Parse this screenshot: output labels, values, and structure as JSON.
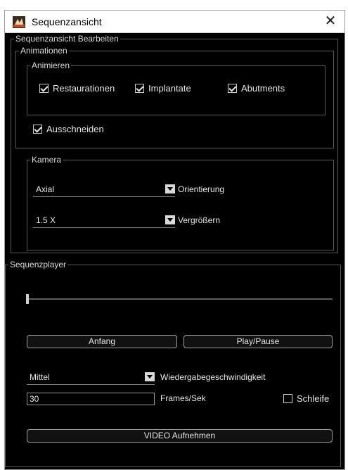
{
  "window": {
    "title": "Sequenzansicht",
    "close_glyph": "✕",
    "icon": "app-icon"
  },
  "edit_group": {
    "legend": "Sequenzansicht Bearbeiten",
    "animations": {
      "legend": "Animationen",
      "animate": {
        "legend": "Animieren",
        "items": [
          {
            "label": "Restaurationen",
            "checked": true
          },
          {
            "label": "Implantate",
            "checked": true
          },
          {
            "label": "Abutments",
            "checked": true
          }
        ]
      },
      "cut": {
        "label": "Ausschneiden",
        "checked": true
      }
    },
    "camera": {
      "legend": "Kamera",
      "orientation": {
        "value": "Axial",
        "label": "Orientierung"
      },
      "zoom": {
        "value": "1.5 X",
        "label": "Vergrößern"
      }
    }
  },
  "player": {
    "legend": "Sequenzplayer",
    "slider_position": 0,
    "start_button": "Anfang",
    "playpause_button": "Play/Pause",
    "speed": {
      "value": "Mittel",
      "label": "Wiedergabegeschwindigkeit"
    },
    "fps": {
      "value": "30",
      "label": "Frames/Sek"
    },
    "loop": {
      "label": "Schleife",
      "checked": false
    },
    "record_button": "VIDEO Aufnehmen"
  },
  "colors": {
    "background": "#000000",
    "text": "#e6e6e6",
    "border": "#5a5a5a"
  }
}
